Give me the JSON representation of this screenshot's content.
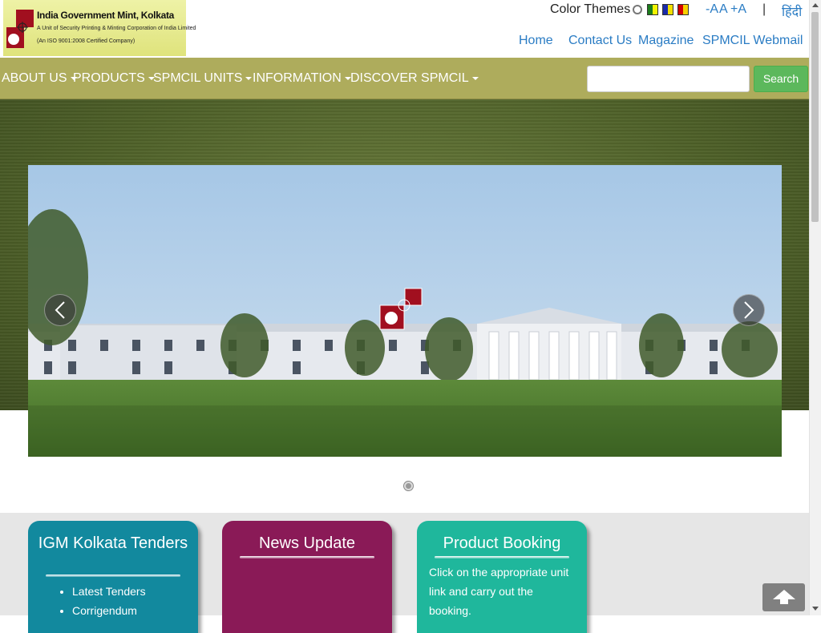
{
  "header": {
    "logo": {
      "title": "India Government Mint, Kolkata",
      "subtitle": "A Unit of Security Printing & Minting Corporation of India Limited",
      "certification": "(An ISO 9001:2008 Certified Company)"
    },
    "color_themes_label": "Color Themes",
    "theme_swatches": [
      {
        "name": "green-yellow",
        "colors": [
          "#1c7d1c",
          "#f3f300"
        ]
      },
      {
        "name": "blue-yellow",
        "colors": [
          "#1b2aa8",
          "#f3e000"
        ]
      },
      {
        "name": "red-yellow",
        "colors": [
          "#d30000",
          "#f7d000"
        ]
      }
    ],
    "font_size": {
      "decrease": "-A",
      "normal": "A",
      "increase": "+A"
    },
    "separator": "|",
    "language_link": "हिंदी",
    "top_links": {
      "home": "Home",
      "contact": "Contact Us",
      "magazine": "Magazine",
      "webmail": "SPMCIL Webmail"
    }
  },
  "nav": {
    "items": [
      {
        "label": "ABOUT US"
      },
      {
        "label": "PRODUCTS"
      },
      {
        "label": "SPMCIL UNITS"
      },
      {
        "label": "INFORMATION"
      },
      {
        "label": "DISCOVER SPMCIL"
      }
    ],
    "search": {
      "value": "",
      "button_label": "Search"
    }
  },
  "carousel": {
    "prev_icon": "chevron-left-icon",
    "next_icon": "chevron-right-icon",
    "slide_count": 1,
    "active_slide": 1
  },
  "panels": [
    {
      "title": "IGM Kolkata Tenders",
      "items": [
        "Latest Tenders",
        "Corrigendum"
      ]
    },
    {
      "title": "News Update",
      "items": []
    },
    {
      "title": "Product Booking",
      "text": "Click on the appropriate unit link and carry out the booking."
    }
  ],
  "colors": {
    "nav_bg": "#aeac5c",
    "search_button": "#5cb85c",
    "link": "#2a7cc4",
    "panel_tenders": "#12899e",
    "panel_news": "#8a1a57",
    "panel_booking": "#1fb79c"
  },
  "back_to_top_icon": "arrow-up-icon"
}
